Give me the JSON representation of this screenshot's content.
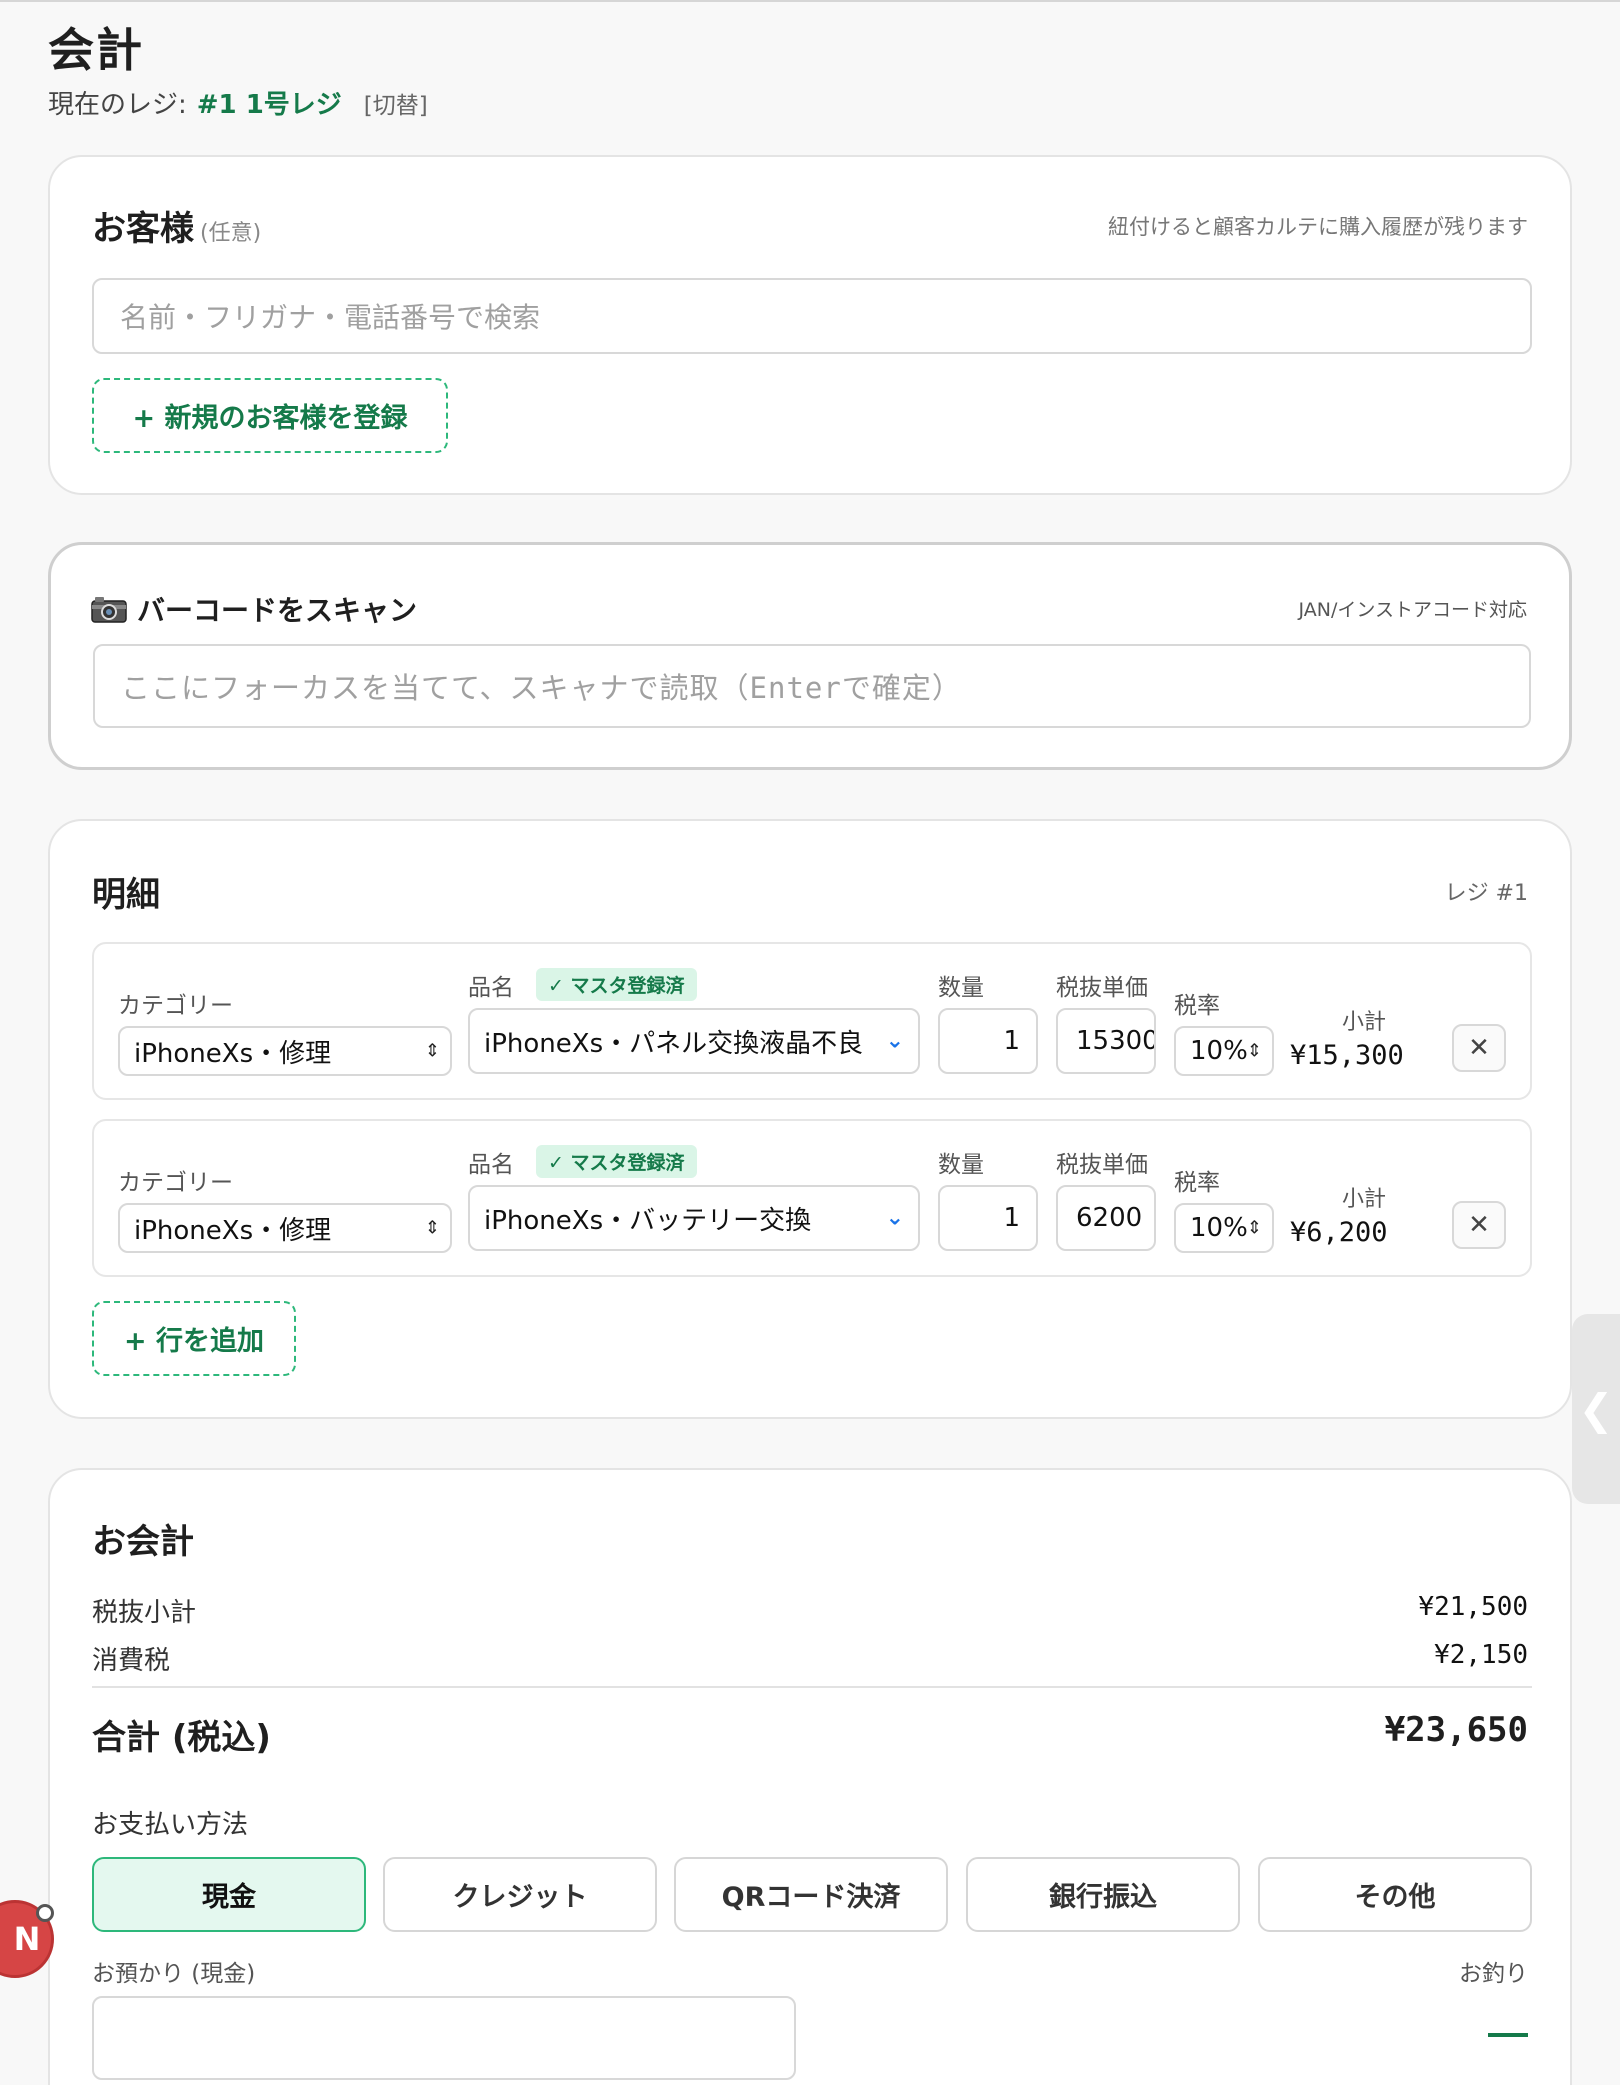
{
  "page": {
    "title": "会計"
  },
  "register": {
    "label": "現在のレジ:",
    "name": "#1 1号レジ",
    "switch": "[切替]"
  },
  "customer": {
    "title": "お客様",
    "optional": "(任意)",
    "note": "紐付けると顧客カルテに購入履歴が残ります",
    "search_placeholder": "名前・フリガナ・電話番号で検索",
    "add_button": "+ 新規のお客様を登録"
  },
  "barcode": {
    "title": "バーコードをスキャン",
    "icon": "camera-icon",
    "note": "JAN/インストアコード対応",
    "placeholder": "ここにフォーカスを当てて、スキャナで読取（Enterで確定）"
  },
  "items": {
    "title": "明細",
    "register_tag": "レジ #1",
    "labels": {
      "category": "カテゴリー",
      "product": "品名",
      "badge": "✓ マスタ登録済",
      "qty": "数量",
      "price": "税抜単価",
      "tax": "税率",
      "subtotal": "小計"
    },
    "rows": [
      {
        "category": "iPhoneXs・修理",
        "product": "iPhoneXs・パネル交換液晶不良",
        "qty": "1",
        "price": "15300",
        "tax": "10%",
        "subtotal": "¥15,300"
      },
      {
        "category": "iPhoneXs・修理",
        "product": "iPhoneXs・バッテリー交換",
        "qty": "1",
        "price": "6200",
        "tax": "10%",
        "subtotal": "¥6,200"
      }
    ],
    "add_row": "+ 行を追加"
  },
  "payment": {
    "title": "お会計",
    "subtotal_label": "税抜小計",
    "subtotal_value": "¥21,500",
    "tax_label": "消費税",
    "tax_value": "¥2,150",
    "total_label": "合計 (税込)",
    "total_value": "¥23,650",
    "methods_label": "お支払い方法",
    "methods": [
      "現金",
      "クレジット",
      "QRコード決済",
      "銀行振込",
      "その他"
    ],
    "selected_method": "現金",
    "deposit_label": "お預かり (現金)",
    "change_label": "お釣り",
    "change_value": "—"
  },
  "floating": {
    "bubble_letter": "N",
    "side_handle_icon": "chevron-left-icon"
  },
  "colors": {
    "accent": "#157a4a",
    "accent_light": "#e4f8ef",
    "badge_bg": "#daf5e7",
    "danger": "#d64545"
  }
}
